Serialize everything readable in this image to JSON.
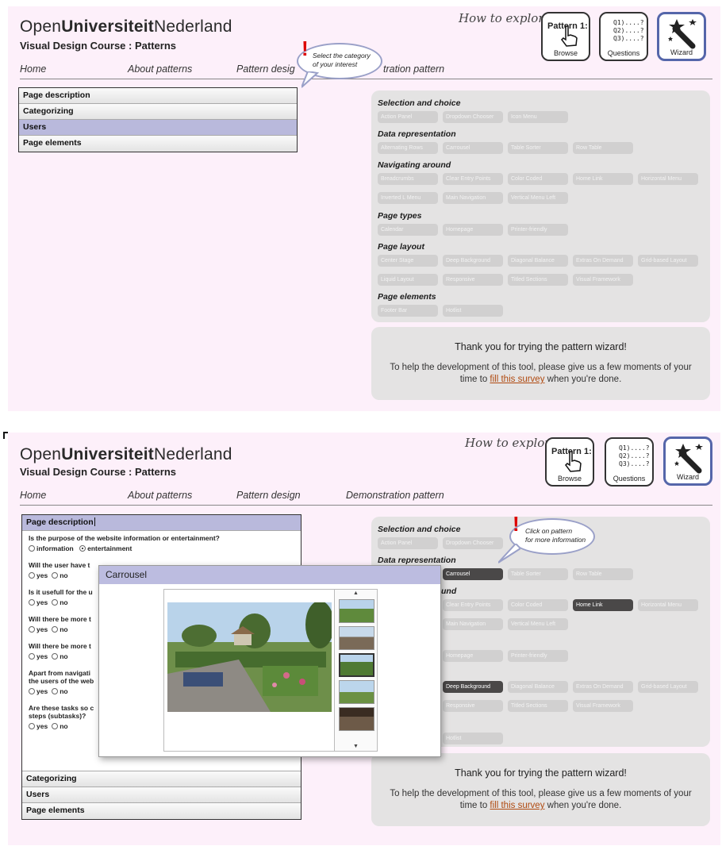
{
  "brand": {
    "part1": "Open",
    "part2": "Universiteit",
    "part3": "Nederland"
  },
  "course": "Visual Design Course : Patterns",
  "how_to": "How to explore?",
  "modes": [
    {
      "label": "Browse",
      "text": "Pattern 1:"
    },
    {
      "label": "Questions",
      "text": "Q1)....? Q2)....? Q3)....?"
    },
    {
      "label": "Wizard"
    }
  ],
  "nav": [
    "Home",
    "About patterns",
    "Pattern design",
    "Demonstration pattern"
  ],
  "nav_partial_1": "tration pattern",
  "nav_partial_pd": "Pattern desig",
  "categories": [
    "Page description",
    "Categorizing",
    "Users",
    "Page elements"
  ],
  "selected_category_top": "Users",
  "sections": {
    "selection": "Selection and choice",
    "data": "Data representation",
    "navigating": "Navigating around",
    "navigating_partial": "und",
    "page_types": "Page types",
    "layout": "Page layout",
    "elements": "Page elements"
  },
  "patterns": {
    "selection": [
      "Action Panel",
      "Dropdown Chooser",
      "Icon Menu"
    ],
    "data": [
      "Alternating Rows",
      "Carrousel",
      "Table Sorter",
      "Row Table"
    ],
    "navigating": [
      "Breadcrumbs",
      "Clear Entry Points",
      "Color Coded",
      "Home Link",
      "Horizontal Menu",
      "Inverted L Menu",
      "Main Navigation",
      "Vertical Menu Left"
    ],
    "page_types": [
      "Calendar",
      "Homepage",
      "Printer-friendly"
    ],
    "layout": [
      "Center Stage",
      "Deep Background",
      "Diagonal Balance",
      "Extras On Demand",
      "Grid-based Layout",
      "Liquid Layout",
      "Responsive",
      "Titled Sections",
      "Visual Framework"
    ],
    "elements": [
      "Footer Bar",
      "Hotlist"
    ]
  },
  "thanks": {
    "title": "Thank you for trying the pattern wizard!",
    "body_before": "To help the development of this tool, please give us a few moments of your time to ",
    "link": "fill this survey",
    "body_after": " when you're done."
  },
  "callout_top": {
    "line1": "Select the category",
    "line2": "of your interest"
  },
  "callout_bottom": {
    "line1": "Click on pattern",
    "line2": "for more information"
  },
  "questions": [
    {
      "text": "Is the purpose of the website information or entertainment?",
      "options": [
        "information",
        "entertainment"
      ],
      "selected": "entertainment"
    },
    {
      "text": "Will the user have t",
      "options": [
        "yes",
        "no"
      ]
    },
    {
      "text": "Is it usefull for the u",
      "options": [
        "yes",
        "no"
      ]
    },
    {
      "text": "Will there be more t",
      "options": [
        "yes",
        "no"
      ]
    },
    {
      "text": "Will there be more t",
      "options": [
        "yes",
        "no"
      ]
    },
    {
      "text": "Apart from navigati",
      "text2": "the users of the web",
      "options": [
        "yes",
        "no"
      ]
    },
    {
      "text": "Are these tasks so c",
      "text2": "steps (subtasks)?",
      "options": [
        "yes",
        "no"
      ]
    }
  ],
  "modal": {
    "title": "Carrousel"
  },
  "highlighted_patterns": [
    "Carrousel",
    "Home Link",
    "Deep Background"
  ]
}
